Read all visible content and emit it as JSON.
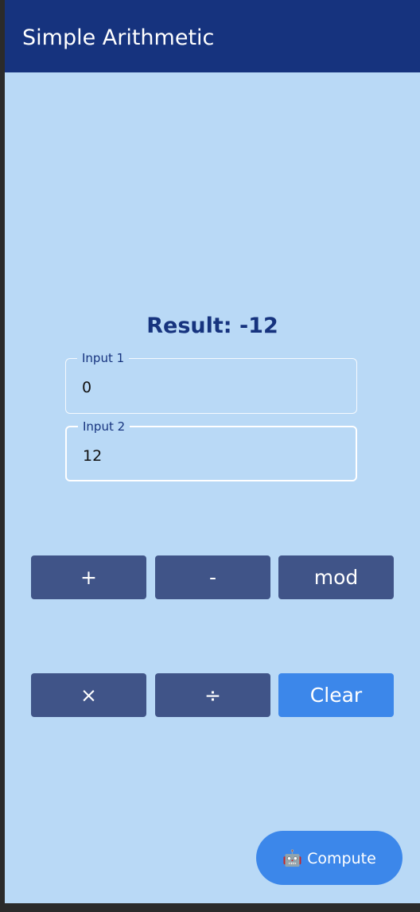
{
  "appbar": {
    "title": "Simple Arithmetic"
  },
  "result": {
    "text": "Result: -12"
  },
  "inputs": [
    {
      "label": "Input 1",
      "value": "0"
    },
    {
      "label": "Input 2",
      "value": "12"
    }
  ],
  "operations": {
    "row1": [
      {
        "label": "+"
      },
      {
        "label": "-"
      },
      {
        "label": "mod"
      }
    ],
    "row2": [
      {
        "label": "×"
      },
      {
        "label": "÷"
      },
      {
        "label": "Clear"
      }
    ]
  },
  "fab": {
    "icon": "robot-icon",
    "icon_glyph": "🤖",
    "label": "Compute"
  },
  "colors": {
    "appbar": "#16337e",
    "background": "#b9d9f6",
    "button": "#405488",
    "accent": "#3c87ea"
  }
}
